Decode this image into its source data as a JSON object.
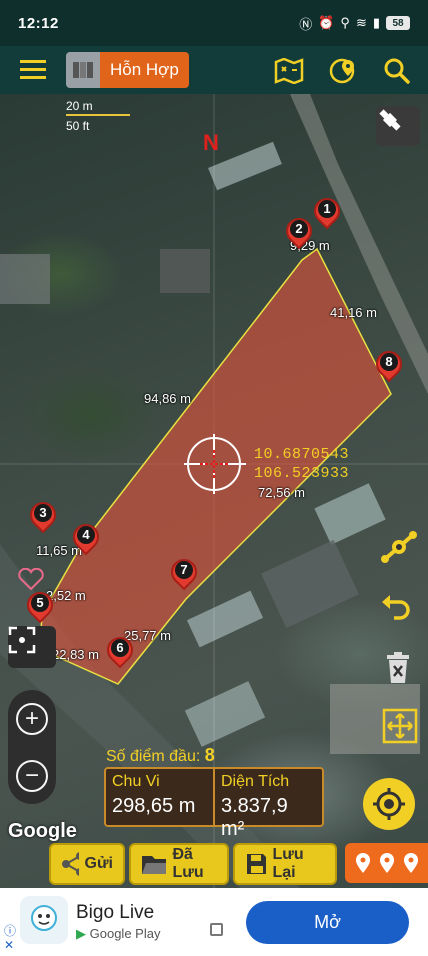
{
  "status": {
    "time": "12:12",
    "battery": "58"
  },
  "toolbar": {
    "mode_label": "Hỗn Hợp"
  },
  "map": {
    "scale_metric": "20 m",
    "scale_imperial": "50 ft",
    "north": "N",
    "coord_lat": "10.6870543",
    "coord_lon": "106.523933",
    "distances": [
      "9,29 m",
      "41,16 m",
      "94,86 m",
      "72,56 m",
      "11,65 m",
      "2,52 m",
      "25,77 m",
      "22,83 m"
    ],
    "pins": [
      "1",
      "2",
      "3",
      "4",
      "5",
      "6",
      "7",
      "8"
    ],
    "polygon_color": "#e0533c",
    "google_logo": "Google"
  },
  "info": {
    "count_label": "Số điểm đầu:",
    "count_value": "8",
    "perimeter_label": "Chu Vi",
    "perimeter_value": "298,65 m",
    "area_label": "Diện Tích",
    "area_value": "3.837,9 m²"
  },
  "bottom": {
    "share": "Gửi",
    "saved": "Đã Lưu",
    "save": "Lưu Lại"
  },
  "ad": {
    "app_name": "Bigo Live",
    "store": "Google Play",
    "open": "Mở"
  },
  "colors": {
    "accent": "#e8c81c",
    "header": "#113c39",
    "orange": "#e0651a"
  }
}
